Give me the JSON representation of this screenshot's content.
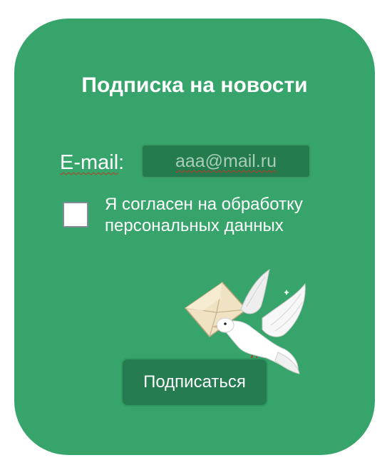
{
  "form": {
    "title": "Подписка на новости",
    "email_label": "E-mail",
    "email_label_suffix": ":",
    "email_value": "aaa@mail.ru",
    "consent_line1": "Я согласен на обработку",
    "consent_line2": "персональных данных",
    "consent_checked": false,
    "subscribe_label": "Подписаться"
  },
  "colors": {
    "card": "#37a46b",
    "input_bg": "#237b4e",
    "button_bg": "#257c50",
    "text": "#ffffff"
  },
  "illustration": {
    "icon": "dove-with-envelope-icon"
  }
}
